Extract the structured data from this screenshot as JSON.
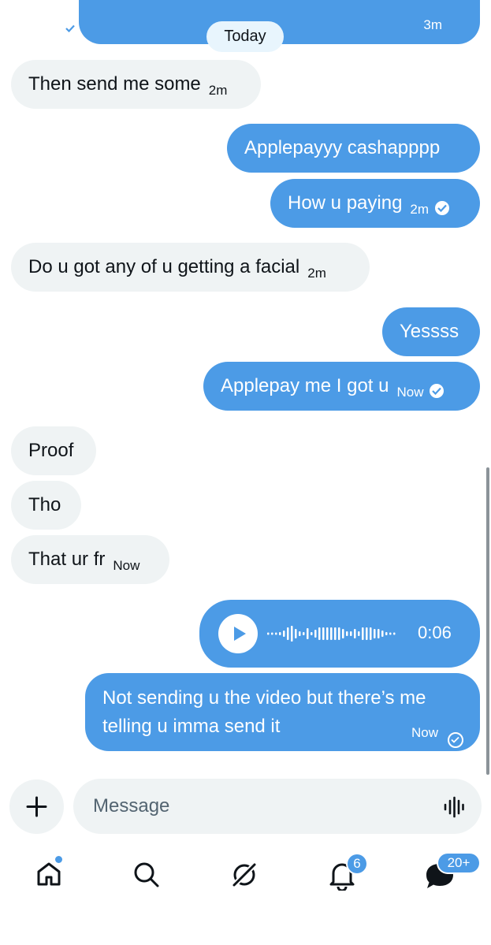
{
  "chat": {
    "top_partial": {
      "time": "3m"
    },
    "date_divider": "Today",
    "messages": [
      {
        "dir": "in",
        "text": "Then send me some",
        "time": "2m"
      },
      {
        "dir": "out",
        "text": "Applepayyy cashapppp"
      },
      {
        "dir": "out",
        "text": "How u paying",
        "time": "2m"
      },
      {
        "dir": "in",
        "text": "Do u got any of u getting a facial",
        "time": "2m"
      },
      {
        "dir": "out",
        "text": "Yessss"
      },
      {
        "dir": "out",
        "text": "Applepay me I got u",
        "time": "Now"
      },
      {
        "dir": "in",
        "text": "Proof"
      },
      {
        "dir": "in",
        "text": "Tho"
      },
      {
        "dir": "in",
        "text": "That ur fr",
        "time": "Now"
      }
    ],
    "voice_note": {
      "duration": "0:06"
    },
    "last_message": {
      "line1": "Not sending u the video but there’s me",
      "line2": "telling u imma send it",
      "time": "Now"
    }
  },
  "composer": {
    "placeholder": "Message"
  },
  "nav": {
    "notifications_badge": "6",
    "messages_badge": "20+"
  },
  "colors": {
    "outgoing": "#4c9be6",
    "incoming": "#eff3f4",
    "badge": "#4c9be6"
  }
}
